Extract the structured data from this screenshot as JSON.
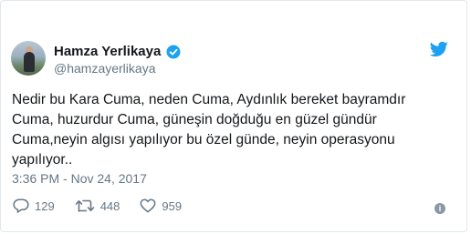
{
  "tweet": {
    "author_name": "Hamza Yerlikaya",
    "handle": "@hamzayerlikaya",
    "text_lines": [
      "Nedir bu Kara Cuma, neden Cuma, Aydınlık bereket bayramdır",
      "Cuma, huzurdur Cuma, güneşin doğduğu en güzel gündür",
      "Cuma,neyin algısı yapılıyor bu özel günde, neyin operasyonu",
      "yapılıyor.."
    ],
    "timestamp": "3:36 PM - Nov 24, 2017",
    "replies": "129",
    "retweets": "448",
    "likes": "959",
    "info_glyph": "i"
  },
  "colors": {
    "twitter_blue": "#1da1f2",
    "muted": "#657786",
    "text": "#14171a",
    "border": "#e1e8ed"
  },
  "icons": {
    "avatar": "profile-photo",
    "verified": "verified-badge-icon",
    "brand": "twitter-bird-icon",
    "reply": "reply-icon",
    "retweet": "retweet-icon",
    "like": "heart-icon",
    "info": "info-icon"
  }
}
